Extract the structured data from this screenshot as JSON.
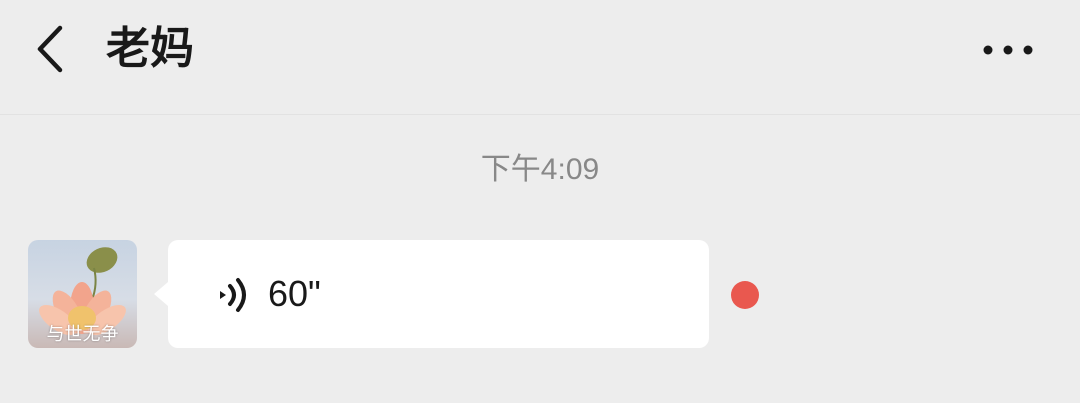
{
  "header": {
    "title": "老妈",
    "back_icon": "chevron-left-icon",
    "more_icon": "more-horizontal-icon"
  },
  "chat": {
    "timestamp": "下午4:09",
    "messages": [
      {
        "sender_avatar_text": "与世无争",
        "type": "voice",
        "duration": "60\"",
        "unread": true,
        "voice_icon": "voice-wave-icon"
      }
    ]
  },
  "colors": {
    "background": "#ededed",
    "bubble": "#ffffff",
    "unread_dot": "#e9584f",
    "timestamp_text": "#888888",
    "primary_text": "#191919"
  }
}
